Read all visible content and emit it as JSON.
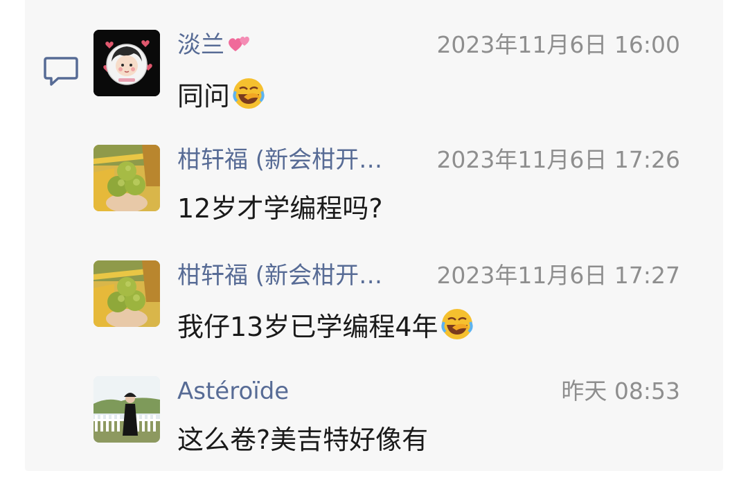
{
  "comments": [
    {
      "author": "淡兰",
      "author_emoji": "heart-emoji",
      "time": "2023年11月6日 16:00",
      "text": "同问",
      "text_emoji": "facepalm-cry-emoji"
    },
    {
      "author": "柑轩福 (新会柑开…",
      "time": "2023年11月6日 17:26",
      "text": "12岁才学编程吗?"
    },
    {
      "author": "柑轩福 (新会柑开…",
      "time": "2023年11月6日 17:27",
      "text": "我仔13岁已学编程4年",
      "text_emoji": "facepalm-cry-emoji"
    },
    {
      "author": "Astéroïde",
      "time": "昨天 08:53",
      "text": "这么卷?美吉特好像有"
    }
  ],
  "colors": {
    "author": "#576b95",
    "time": "#8e8e8e",
    "text": "#1a1a1a",
    "panel": "#f7f7f7"
  },
  "icons": {
    "comment_section": "comment-bubble-icon"
  }
}
